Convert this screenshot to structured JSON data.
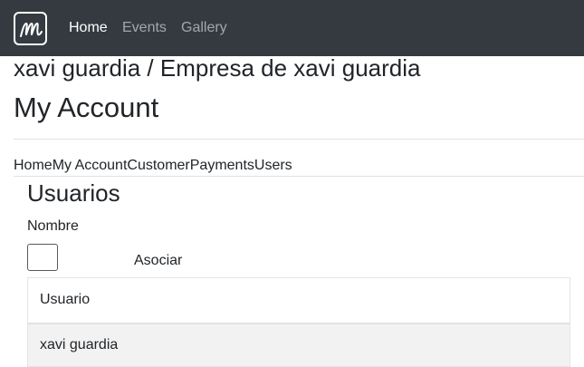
{
  "navbar": {
    "brand_icon": "m-script-logo",
    "links": [
      {
        "label": "Home",
        "active": true
      },
      {
        "label": "Events",
        "active": false
      },
      {
        "label": "Gallery",
        "active": false
      }
    ]
  },
  "header": {
    "org_title": "xavi guardia / Empresa de xavi guardia",
    "page_title": "My Account"
  },
  "tabs": [
    "Home",
    "My Account",
    "Customer",
    "Payments",
    "Users"
  ],
  "users_section": {
    "title": "Usuarios",
    "name_label": "Nombre",
    "name_value": "",
    "associate_label": "Asociar",
    "table": {
      "columns": [
        "Usuario"
      ],
      "rows": [
        [
          "xavi guardia"
        ]
      ]
    }
  },
  "colors": {
    "navbar_bg": "#343a40",
    "row_bg": "#f2f2f2"
  }
}
